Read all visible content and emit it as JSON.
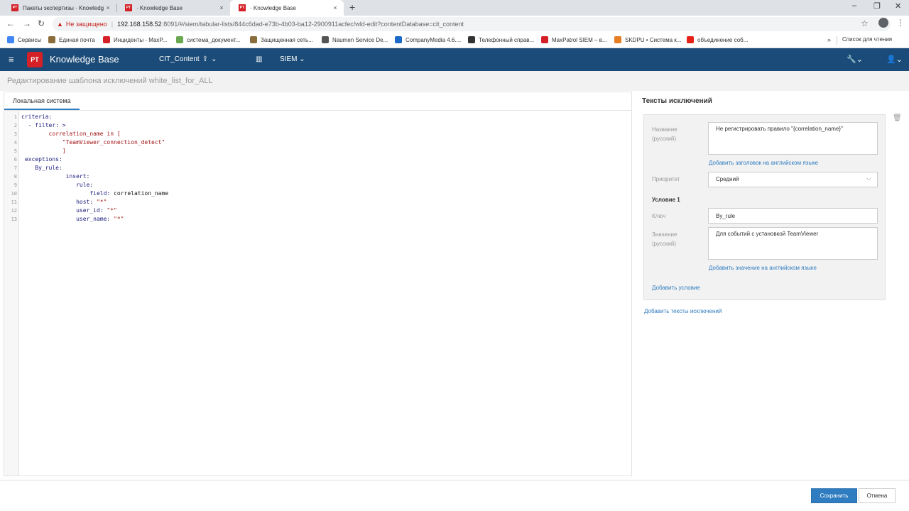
{
  "browser": {
    "tabs": [
      {
        "label": "Пакеты экспертизы · Knowledge",
        "favicon": "PT",
        "close": "×"
      },
      {
        "label": "· Knowledge Base",
        "favicon": "PT",
        "close": "×"
      },
      {
        "label": "· Knowledge Base",
        "favicon": "PT",
        "close": "×"
      }
    ],
    "new_tab": "+",
    "window_controls": {
      "minimize": "–",
      "restore": "❐",
      "close": "✕"
    },
    "nav": {
      "back": "←",
      "forward": "→",
      "reload": "↻"
    },
    "address": {
      "warning_icon": "▲",
      "security_label": "Не защищено",
      "separator": "|",
      "host": "192.168.158.52",
      "path": ":8091/#/siem/tabular-lists/844c6dad-e73b-4b03-ba12-2900911acfec/wld-edit?contentDatabase=cit_content"
    },
    "bookmarks": [
      {
        "label": "Сервисы",
        "color": "#4285f4"
      },
      {
        "label": "Единая почта",
        "color": "#8a6d3b"
      },
      {
        "label": "Инциденты - MaxP...",
        "color": "#d42027"
      },
      {
        "label": "система_документ...",
        "color": "#6aa84f"
      },
      {
        "label": "Защищенная сеть...",
        "color": "#8a6d3b"
      },
      {
        "label": "Naumen Service De...",
        "color": "#555555"
      },
      {
        "label": "CompanyMedia 4.6....",
        "color": "#1b6ac9"
      },
      {
        "label": "Телефонный справ...",
        "color": "#333333"
      },
      {
        "label": "MaxPatrol SIEM – в...",
        "color": "#d42027"
      },
      {
        "label": "SKDPU • Система к...",
        "color": "#e67e22"
      },
      {
        "label": "объединение соб...",
        "color": "#e62117"
      }
    ],
    "bookmarks_more": "»",
    "reading_list": "Список для чтения"
  },
  "app": {
    "menu_icon": "≡",
    "logo": "PT",
    "title": "Knowledge Base",
    "context": "CIT_Content",
    "context_icon": "⇪",
    "context_chevron": "⌄",
    "siem_icon": "▥",
    "siem": "SIEM",
    "siem_chevron": "⌄",
    "tools_icon": "🔧⌄",
    "user_icon": "👤⌄"
  },
  "page": {
    "title": "Редактирование шаблона исключений white_list_for_ALL"
  },
  "editor": {
    "tab": "Локальная система",
    "line_numbers": [
      "1",
      "2",
      "3",
      "4",
      "5",
      "6",
      "7",
      "8",
      "9",
      "10",
      "11",
      "12",
      "13"
    ],
    "lines": [
      {
        "kw": "criteria:",
        "val": ""
      },
      {
        "kw": "  - filter: >",
        "val": ""
      },
      {
        "kw": "",
        "val": "        correlation_name in ["
      },
      {
        "kw": "",
        "val": "            \"TeamViewer_connection_detect\""
      },
      {
        "kw": "",
        "val": "            ]"
      },
      {
        "kw": " exceptions:",
        "val": ""
      },
      {
        "kw": "    By_rule:",
        "val": ""
      },
      {
        "kw": "             insert:",
        "val": ""
      },
      {
        "kw": "                rule:",
        "val": ""
      },
      {
        "kw": "                    field: ",
        "val": "correlation_name"
      },
      {
        "kw": "                host: ",
        "val": "\"*\""
      },
      {
        "kw": "                user_id: ",
        "val": "\"*\""
      },
      {
        "kw": "                user_name: ",
        "val": "\"*\""
      }
    ]
  },
  "exceptions_panel": {
    "title": "Тексты исключений",
    "delete_icon": "🗑",
    "name_label": "Название\n(русский)",
    "name_value": "Не регистрировать правило \"{correlation_name}\"",
    "add_title_en": "Добавить заголовок на английском языке",
    "priority_label": "Приоритет",
    "priority_value": "Средний",
    "priority_chevron": "⌵",
    "condition_heading": "Условие 1",
    "key_label": "Ключ",
    "key_value": "By_rule",
    "value_label": "Значение\n(русский)",
    "value_value": "Для событий с установкой TeamViewer",
    "add_value_en": "Добавить значение на английском языке",
    "add_condition": "Добавить условие",
    "add_texts": "Добавить тексты исключений"
  },
  "footer": {
    "save": "Сохранить",
    "cancel": "Отмена"
  }
}
